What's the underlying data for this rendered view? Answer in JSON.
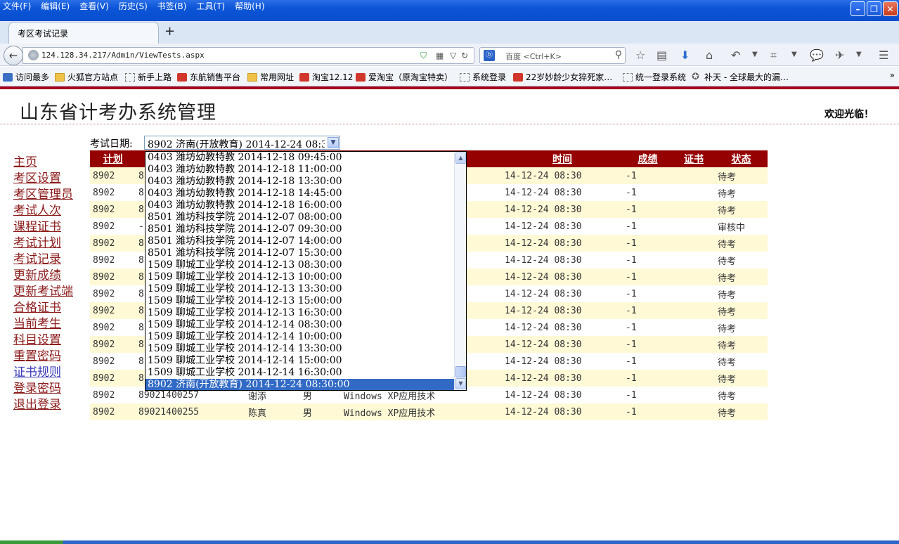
{
  "browser": {
    "menu": [
      "文件(F)",
      "编辑(E)",
      "查看(V)",
      "历史(S)",
      "书签(B)",
      "工具(T)",
      "帮助(H)"
    ],
    "tab_title": "考区考试记录",
    "new_tab": "+",
    "url": "124.128.34.217/Admin/ViewTests.aspx",
    "search_engine": "百度",
    "search_placeholder": "百度 <Ctrl+K>",
    "bookmarks": [
      "访问最多",
      "火狐官方站点",
      "新手上路",
      "东航销售平台",
      "常用网址",
      "淘宝12.12",
      "爱淘宝（原淘宝特卖）",
      "系统登录",
      "22岁妙龄少女猝死家…",
      "统一登录系统",
      "补天 - 全球最大的漏…"
    ],
    "bookmarks_more": "»"
  },
  "page": {
    "title": "山东省计考办系统管理",
    "welcome": "欢迎光临！"
  },
  "sidebar": {
    "items": [
      {
        "label": "主页"
      },
      {
        "label": "考区设置"
      },
      {
        "label": "考区管理员"
      },
      {
        "label": "考试人次"
      },
      {
        "label": "课程证书"
      },
      {
        "label": "考试计划"
      },
      {
        "label": "考试记录"
      },
      {
        "label": "更新成绩"
      },
      {
        "label": "更新考试端"
      },
      {
        "label": "合格证书"
      },
      {
        "label": "当前考生"
      },
      {
        "label": "科目设置"
      },
      {
        "label": "重置密码"
      },
      {
        "label": "证书规则"
      },
      {
        "label": "登录密码"
      },
      {
        "label": "退出登录"
      }
    ]
  },
  "filter": {
    "label": "考试日期:",
    "selected": "8902 济南(开放教育) 2014-12-24 08:30:00",
    "options": [
      "0403 潍坊幼教特教 2014-12-18 09:45:00",
      "0403 潍坊幼教特教 2014-12-18 11:00:00",
      "0403 潍坊幼教特教 2014-12-18 13:30:00",
      "0403 潍坊幼教特教 2014-12-18 14:45:00",
      "0403 潍坊幼教特教 2014-12-18 16:00:00",
      "8501 潍坊科技学院 2014-12-07 08:00:00",
      "8501 潍坊科技学院 2014-12-07 09:30:00",
      "8501 潍坊科技学院 2014-12-07 14:00:00",
      "8501 潍坊科技学院 2014-12-07 15:30:00",
      "1509 聊城工业学校 2014-12-13 08:30:00",
      "1509 聊城工业学校 2014-12-13 10:00:00",
      "1509 聊城工业学校 2014-12-13 13:30:00",
      "1509 聊城工业学校 2014-12-13 15:00:00",
      "1509 聊城工业学校 2014-12-13 16:30:00",
      "1509 聊城工业学校 2014-12-14 08:30:00",
      "1509 聊城工业学校 2014-12-14 10:00:00",
      "1509 聊城工业学校 2014-12-14 13:30:00",
      "1509 聊城工业学校 2014-12-14 15:00:00",
      "1509 聊城工业学校 2014-12-14 16:30:00",
      "8902 济南(开放教育) 2014-12-24 08:30:00"
    ],
    "selected_index": 19
  },
  "table": {
    "headers": {
      "plan": "计划",
      "time": "时间",
      "score": "成绩",
      "cert": "证书",
      "status": "状态"
    },
    "rows": [
      {
        "plan": "8902",
        "id": "8",
        "name": "",
        "sex": "",
        "course": "",
        "time": "14-12-24 08:30",
        "score": "-1",
        "cert": "",
        "status": "待考"
      },
      {
        "plan": "8902",
        "id": "8",
        "name": "",
        "sex": "",
        "course": "",
        "time": "14-12-24 08:30",
        "score": "-1",
        "cert": "",
        "status": "待考"
      },
      {
        "plan": "8902",
        "id": "8",
        "name": "",
        "sex": "",
        "course": "",
        "time": "14-12-24 08:30",
        "score": "-1",
        "cert": "",
        "status": "待考"
      },
      {
        "plan": "8902",
        "id": "-",
        "name": "",
        "sex": "",
        "course": "",
        "time": "14-12-24 08:30",
        "score": "-1",
        "cert": "",
        "status": "审核中"
      },
      {
        "plan": "8902",
        "id": "8",
        "name": "",
        "sex": "",
        "course": "",
        "time": "14-12-24 08:30",
        "score": "-1",
        "cert": "",
        "status": "待考"
      },
      {
        "plan": "8902",
        "id": "8",
        "name": "",
        "sex": "",
        "course": "",
        "time": "14-12-24 08:30",
        "score": "-1",
        "cert": "",
        "status": "待考"
      },
      {
        "plan": "8902",
        "id": "8",
        "name": "",
        "sex": "",
        "course": "",
        "time": "14-12-24 08:30",
        "score": "-1",
        "cert": "",
        "status": "待考"
      },
      {
        "plan": "8902",
        "id": "8",
        "name": "",
        "sex": "",
        "course": "",
        "time": "14-12-24 08:30",
        "score": "-1",
        "cert": "",
        "status": "待考"
      },
      {
        "plan": "8902",
        "id": "8",
        "name": "",
        "sex": "",
        "course": "",
        "time": "14-12-24 08:30",
        "score": "-1",
        "cert": "",
        "status": "待考"
      },
      {
        "plan": "8902",
        "id": "8",
        "name": "",
        "sex": "",
        "course": "",
        "time": "14-12-24 08:30",
        "score": "-1",
        "cert": "",
        "status": "待考"
      },
      {
        "plan": "8902",
        "id": "8",
        "name": "",
        "sex": "",
        "course": "",
        "time": "14-12-24 08:30",
        "score": "-1",
        "cert": "",
        "status": "待考"
      },
      {
        "plan": "8902",
        "id": "8",
        "name": "",
        "sex": "",
        "course": "",
        "time": "14-12-24 08:30",
        "score": "-1",
        "cert": "",
        "status": "待考"
      },
      {
        "plan": "8902",
        "id": "8",
        "name": "",
        "sex": "",
        "course": "",
        "time": "14-12-24 08:30",
        "score": "-1",
        "cert": "",
        "status": "待考"
      },
      {
        "plan": "8902",
        "id": "89021400257",
        "name": "谢添",
        "sex": "男",
        "course": "Windows XP应用技术",
        "time": "14-12-24 08:30",
        "score": "-1",
        "cert": "",
        "status": "待考"
      },
      {
        "plan": "8902",
        "id": "89021400255",
        "name": "陈真",
        "sex": "男",
        "course": "Windows XP应用技术",
        "time": "14-12-24 08:30",
        "score": "-1",
        "cert": "",
        "status": "待考"
      }
    ]
  },
  "colors": {
    "header_bg": "#950000",
    "row_alt_bg": "#fff9d6",
    "nav_link": "#8b1a1a",
    "nav_link_visited": "#3b3bb8",
    "selection": "#316ac5"
  }
}
